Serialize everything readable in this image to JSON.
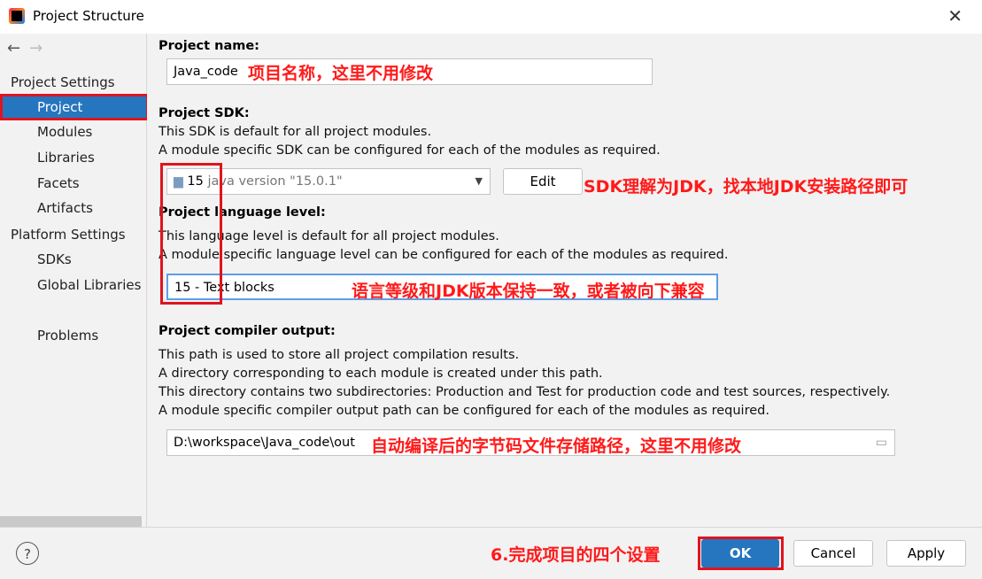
{
  "window": {
    "title": "Project Structure"
  },
  "sidebar": {
    "group_project_settings": "Project Settings",
    "items": [
      "Project",
      "Modules",
      "Libraries",
      "Facets",
      "Artifacts"
    ],
    "group_platform_settings": "Platform Settings",
    "platform_items": [
      "SDKs",
      "Global Libraries"
    ],
    "problems": "Problems"
  },
  "project_name": {
    "heading": "Project name:",
    "value": "Java_code"
  },
  "sdk": {
    "heading": "Project SDK:",
    "desc1": "This SDK is default for all project modules.",
    "desc2": "A module specific SDK can be configured for each of the modules as required.",
    "version": "15",
    "detail": "java version \"15.0.1\"",
    "edit_label": "Edit"
  },
  "language_level": {
    "heading": "Project language level:",
    "desc1": "This language level is default for all project modules.",
    "desc2": "A module specific language level can be configured for each of the modules as required.",
    "value": "15 - Text blocks"
  },
  "compiler_output": {
    "heading": "Project compiler output:",
    "desc1": "This path is used to store all project compilation results.",
    "desc2": "A directory corresponding to each module is created under this path.",
    "desc3": "This directory contains two subdirectories: Production and Test for production code and test sources, respectively.",
    "desc4": "A module specific compiler output path can be configured for each of the modules as required.",
    "path": "D:\\workspace\\Java_code\\out"
  },
  "annotations": {
    "name_note": "项目名称，这里不用修改",
    "sdk_note": "SDK理解为JDK，找本地JDK安装路径即可",
    "level_note": "语言等级和JDK版本保持一致，或者被向下兼容",
    "output_note": "自动编译后的字节码文件存储路径，这里不用修改",
    "step_note": "6.完成项目的四个设置"
  },
  "buttons": {
    "help": "?",
    "ok": "OK",
    "cancel": "Cancel",
    "apply": "Apply"
  },
  "colors": {
    "accent": "#2675bf",
    "annotation": "#ff1a1a"
  }
}
